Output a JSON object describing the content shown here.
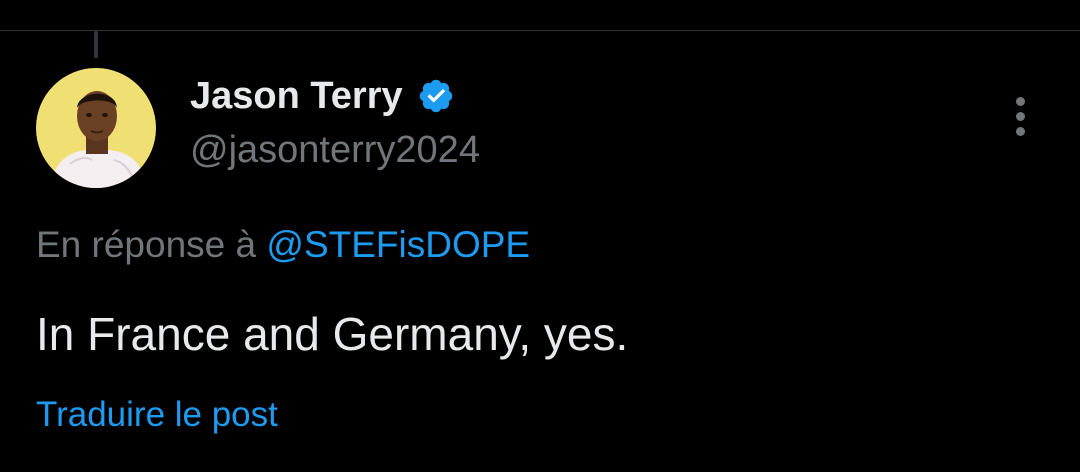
{
  "tweet": {
    "author": {
      "display_name": "Jason Terry",
      "handle": "@jasonterry2024",
      "verified": true,
      "avatar_icon": "profile-photo"
    },
    "reply_prefix": "En réponse à ",
    "reply_to": "@STEFisDOPE",
    "text": "In France and Germany, yes.",
    "translate_label": "Traduire le post",
    "more_icon": "more-vertical-icon"
  },
  "colors": {
    "background": "#000000",
    "primary_text": "#e7e9ea",
    "secondary_text": "#71767b",
    "accent": "#1d9bf0",
    "divider": "#2f3336",
    "avatar_bg": "#f3e27a"
  }
}
